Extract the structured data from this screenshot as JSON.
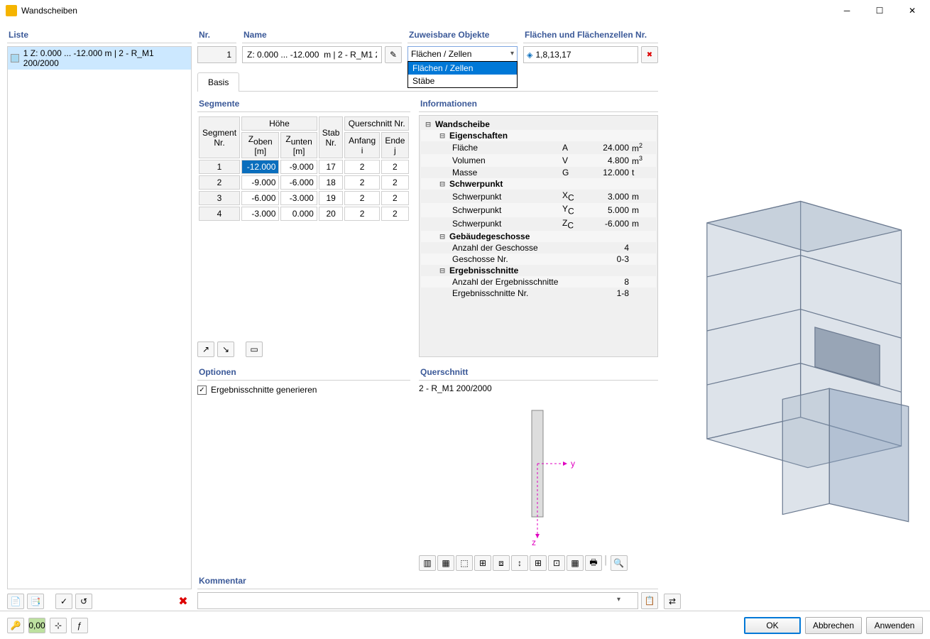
{
  "window": {
    "title": "Wandscheiben"
  },
  "list": {
    "title": "Liste",
    "items": [
      {
        "label": "1  Z: 0.000 ... -12.000 m | 2 - R_M1 200/2000"
      }
    ]
  },
  "nr": {
    "title": "Nr.",
    "value": "1"
  },
  "name": {
    "title": "Name",
    "value": "Z: 0.000 ... -12.000  m | 2 - R_M1 200/2000"
  },
  "assign": {
    "title": "Zuweisbare Objekte",
    "selected": "Flächen / Zellen",
    "options": [
      "Flächen / Zellen",
      "Stäbe"
    ]
  },
  "surfaces": {
    "title": "Flächen und Flächenzellen Nr.",
    "value": "1,8,13,17"
  },
  "tab": {
    "basis": "Basis"
  },
  "segments": {
    "title": "Segmente",
    "headers": {
      "segnr": "Segment\nNr.",
      "hoehe": "Höhe",
      "zoben": "Zoben [m]",
      "zunten": "Zunten [m]",
      "stabnr": "Stab\nNr.",
      "qnr": "Querschnitt Nr.",
      "anfang": "Anfang i",
      "ende": "Ende j"
    },
    "rows": [
      {
        "nr": "1",
        "zoben": "-12.000",
        "zunten": "-9.000",
        "stab": "17",
        "qa": "2",
        "qe": "2"
      },
      {
        "nr": "2",
        "zoben": "-9.000",
        "zunten": "-6.000",
        "stab": "18",
        "qa": "2",
        "qe": "2"
      },
      {
        "nr": "3",
        "zoben": "-6.000",
        "zunten": "-3.000",
        "stab": "19",
        "qa": "2",
        "qe": "2"
      },
      {
        "nr": "4",
        "zoben": "-3.000",
        "zunten": "0.000",
        "stab": "20",
        "qa": "2",
        "qe": "2"
      }
    ]
  },
  "info": {
    "title": "Informationen",
    "tree": {
      "ws": "Wandscheibe",
      "eigen": "Eigenschaften",
      "flaeche": {
        "n": "Fläche",
        "s": "A",
        "v": "24.000",
        "u": "m2"
      },
      "vol": {
        "n": "Volumen",
        "s": "V",
        "v": "4.800",
        "u": "m3"
      },
      "masse": {
        "n": "Masse",
        "s": "G",
        "v": "12.000",
        "u": "t"
      },
      "sp": "Schwerpunkt",
      "xc": {
        "n": "Schwerpunkt",
        "s": "Xc",
        "v": "3.000",
        "u": "m"
      },
      "yc": {
        "n": "Schwerpunkt",
        "s": "Yc",
        "v": "5.000",
        "u": "m"
      },
      "zc": {
        "n": "Schwerpunkt",
        "s": "Zc",
        "v": "-6.000",
        "u": "m"
      },
      "geschosse": "Gebäudegeschosse",
      "anz": {
        "n": "Anzahl der Geschosse",
        "v": "4"
      },
      "gnr": {
        "n": "Geschosse Nr.",
        "v": "0-3"
      },
      "erg": "Ergebnisschnitte",
      "anzerg": {
        "n": "Anzahl der Ergebnisschnitte",
        "v": "8"
      },
      "ergnr": {
        "n": "Ergebnisschnitte Nr.",
        "v": "1-8"
      }
    }
  },
  "options": {
    "title": "Optionen",
    "chk": "Ergebnisschnitte generieren"
  },
  "cross": {
    "title": "Querschnitt",
    "label": "2 - R_M1 200/2000"
  },
  "comment": {
    "title": "Kommentar"
  },
  "buttons": {
    "ok": "OK",
    "cancel": "Abbrechen",
    "apply": "Anwenden"
  }
}
